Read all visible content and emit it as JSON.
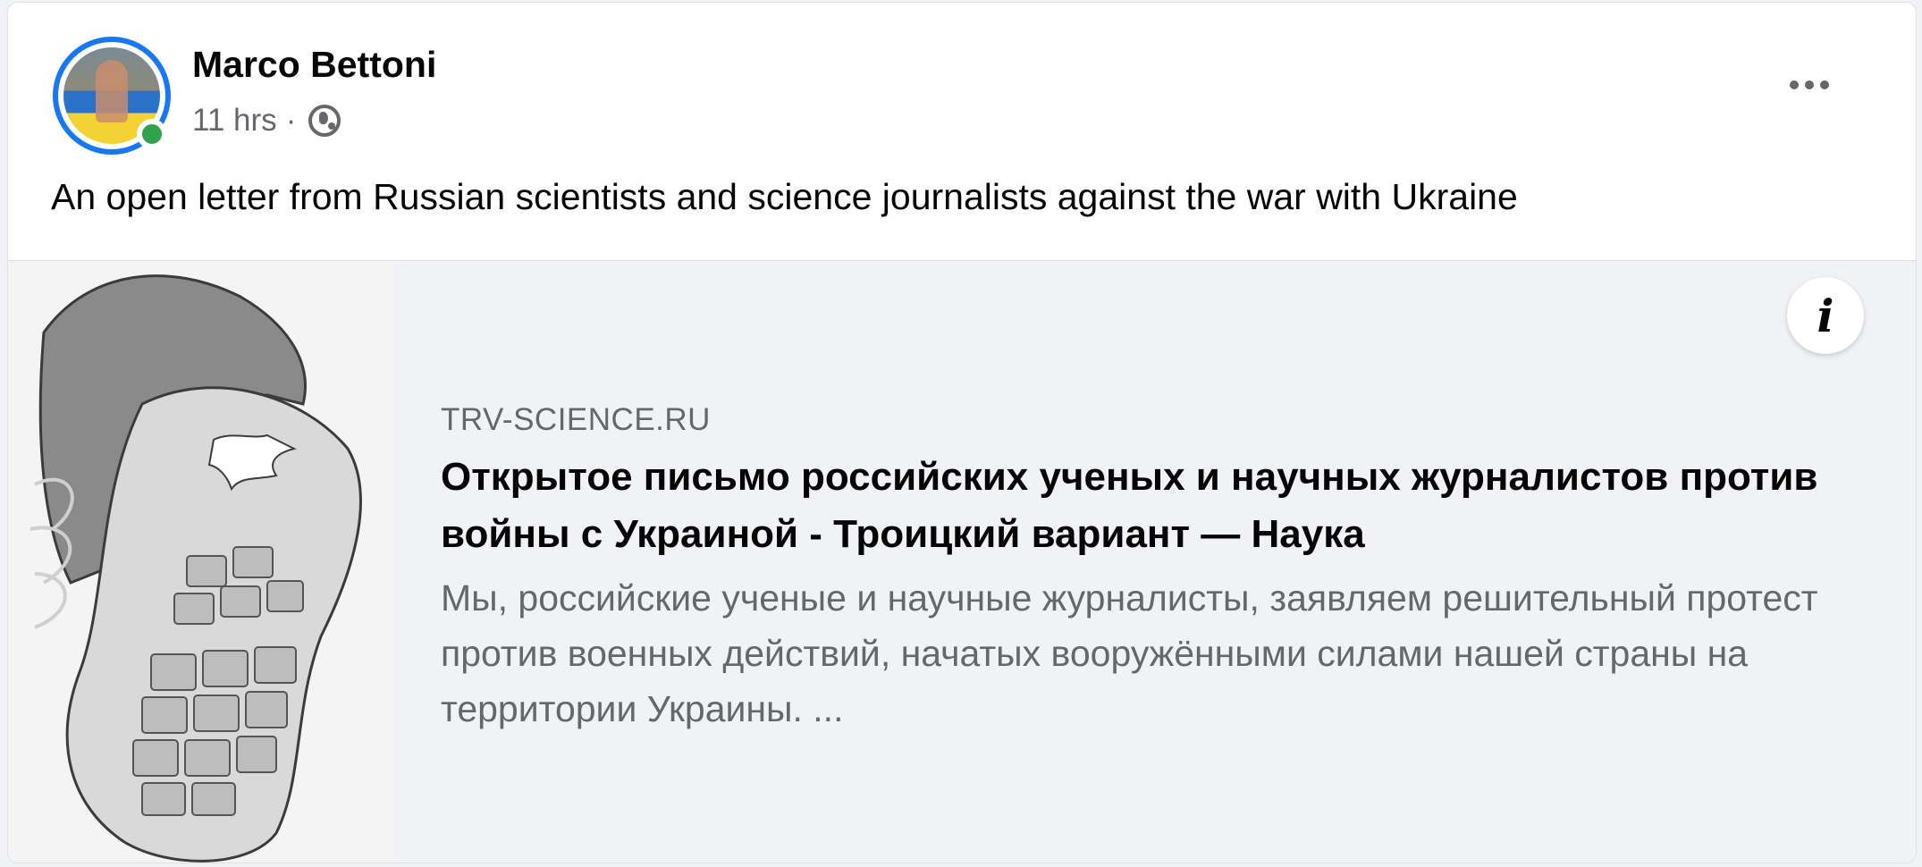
{
  "post": {
    "author": "Marco Bettoni",
    "time": "11 hrs",
    "separator": "·",
    "privacy_icon": "globe-icon",
    "more_icon": "more-options-icon",
    "text": "An open letter from Russian scientists and science journalists against the war with Ukraine"
  },
  "link": {
    "domain": "TRV-SCIENCE.RU",
    "title": "Открытое письмо российских ученых и научных журналистов против войны с Украиной - Троицкий вариант — Наука",
    "description": "Мы, российские ученые и научные журналисты, заявляем решительный протест против военных действий, начатых вооружёнными силами нашей страны на территории Украины. ...",
    "info_icon": "i"
  },
  "colors": {
    "accent": "#1877f2",
    "online": "#31a24c",
    "secondary_text": "#65676b",
    "preview_bg": "#f0f2f5"
  }
}
